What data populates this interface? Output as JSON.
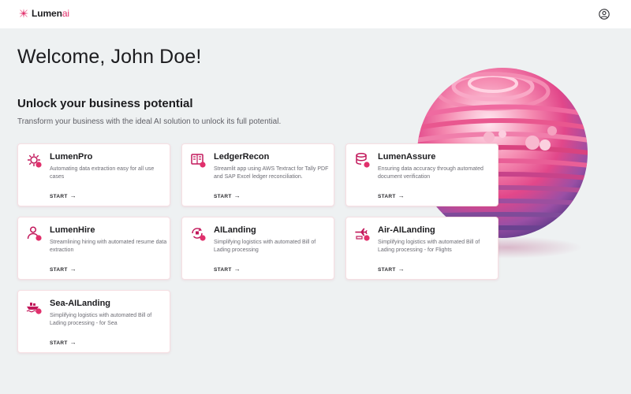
{
  "app": {
    "logo_main": "Lumen",
    "logo_accent": "ai"
  },
  "header": {
    "welcome": "Welcome, John Doe!",
    "subhead": "Unlock your business potential",
    "tagline": "Transform your business with the ideal AI solution to unlock its full potential."
  },
  "colors": {
    "accent": "#e1306c",
    "page_bg": "#eef1f2",
    "card_bg": "#ffffff"
  },
  "cards": [
    {
      "title": "LumenPro",
      "desc": "Automating data extraction easy for all use cases",
      "start": "START",
      "icon": "gear-sparkle-icon"
    },
    {
      "title": "LedgerRecon",
      "desc": "Streamlit app using AWS Textract for Tally PDF and SAP Excel ledger reconciliation.",
      "start": "START",
      "icon": "ledger-book-icon"
    },
    {
      "title": "LumenAssure",
      "desc": "Ensuring data accuracy through automated document verification",
      "start": "START",
      "icon": "database-check-icon"
    },
    {
      "title": "LumenHire",
      "desc": "Streamlining hiring with automated resume data extraction",
      "start": "START",
      "icon": "person-hire-icon"
    },
    {
      "title": "AILanding",
      "desc": "Simplifying logistics with automated Bill of Lading processing",
      "start": "START",
      "icon": "logistics-cycle-icon"
    },
    {
      "title": "Air-AILanding",
      "desc": "Simplifying logistics with automated Bill of Lading processing - for Flights",
      "start": "START",
      "icon": "airplane-icon"
    },
    {
      "title": "Sea-AILanding",
      "desc": "Simplifying logistics with automated Bill of Lading processing - for Sea",
      "start": "START",
      "icon": "ship-icon"
    }
  ]
}
